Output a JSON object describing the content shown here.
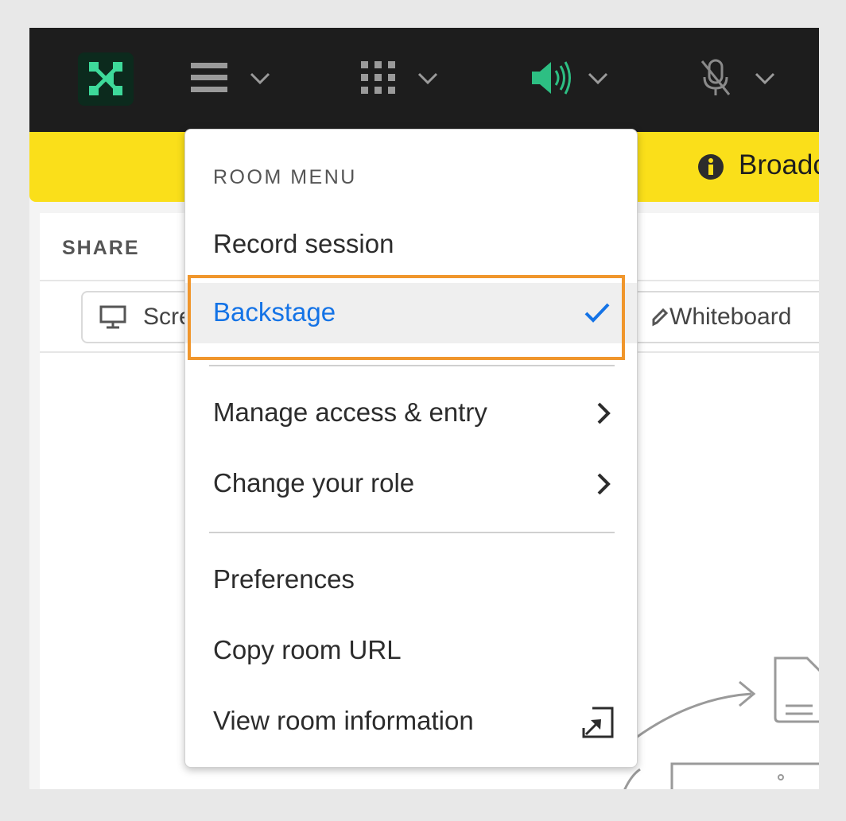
{
  "topbar": {
    "logo_icon": "connect-logo-icon",
    "menu_icon": "hamburger-icon",
    "apps_icon": "grid-icon",
    "audio_icon": "speaker-on-icon",
    "mic_icon": "mic-muted-icon",
    "accent_color": "#2dbf83"
  },
  "banner": {
    "text": "Broadc",
    "icon": "info-icon",
    "background": "#fadf1a"
  },
  "share": {
    "label": "SHARE",
    "screen_label": "Scre",
    "whiteboard_label": "Whiteboard"
  },
  "room_menu": {
    "heading": "ROOM MENU",
    "items": [
      {
        "label": "Record session"
      },
      {
        "label": "Backstage",
        "checked": true
      },
      {
        "label": "Manage access & entry",
        "submenu": true
      },
      {
        "label": "Change your role",
        "submenu": true
      },
      {
        "label": "Preferences"
      },
      {
        "label": "Copy room URL"
      },
      {
        "label": "View room information",
        "icon": "open-external-icon"
      }
    ],
    "selected_color": "#1473e6",
    "highlight_color": "#f0962c"
  }
}
